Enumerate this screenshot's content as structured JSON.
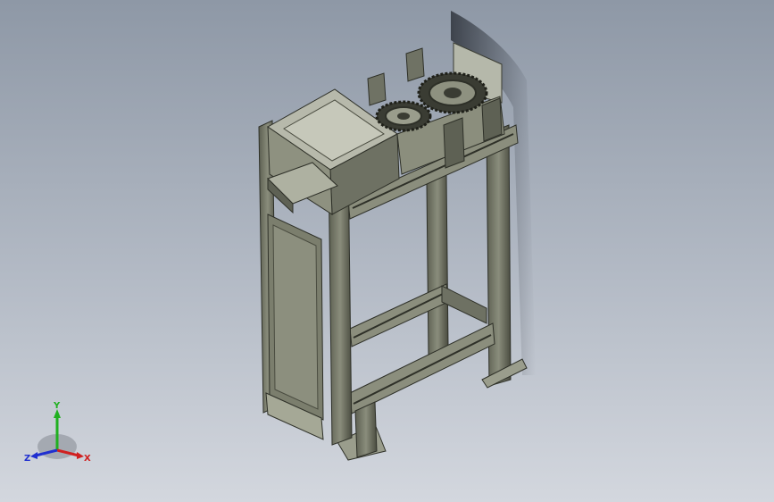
{
  "viewport": {
    "background_top": "#8e98a6",
    "background_bottom": "#d3d7de",
    "model_fill": "#7a7d6e",
    "model_dark": "#3b3d33",
    "model_light": "#a9ab9b",
    "shadow": "#3c424c"
  },
  "triad": {
    "x_label": "X",
    "y_label": "Y",
    "z_label": "Z",
    "x_color": "#d02020",
    "y_color": "#20b020",
    "z_color": "#2030d0"
  }
}
